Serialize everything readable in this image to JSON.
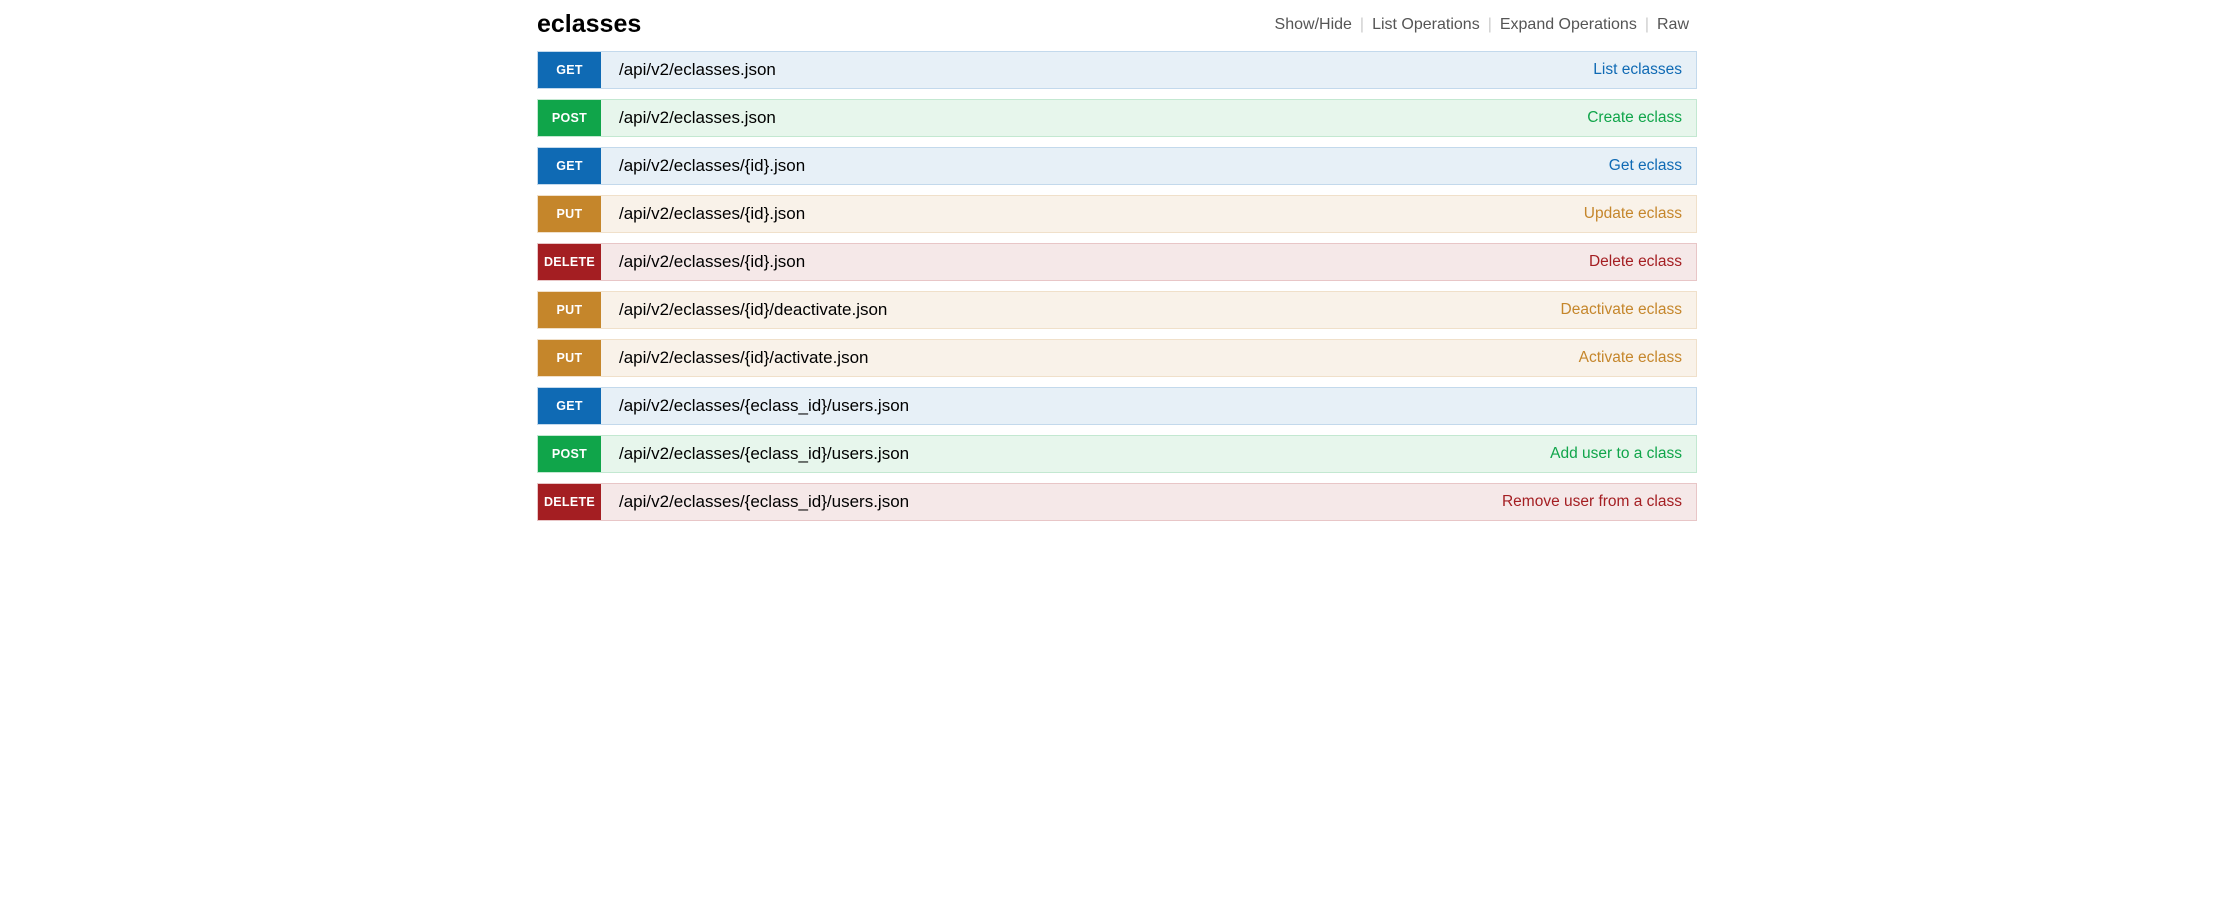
{
  "heading": "eclasses",
  "options": {
    "show_hide": "Show/Hide",
    "list_operations": "List Operations",
    "expand_operations": "Expand Operations",
    "raw": "Raw"
  },
  "endpoints": [
    {
      "method": "GET",
      "path": "/api/v2/eclasses.json",
      "summary": "List eclasses"
    },
    {
      "method": "POST",
      "path": "/api/v2/eclasses.json",
      "summary": "Create eclass"
    },
    {
      "method": "GET",
      "path": "/api/v2/eclasses/{id}.json",
      "summary": "Get eclass"
    },
    {
      "method": "PUT",
      "path": "/api/v2/eclasses/{id}.json",
      "summary": "Update eclass"
    },
    {
      "method": "DELETE",
      "path": "/api/v2/eclasses/{id}.json",
      "summary": "Delete eclass"
    },
    {
      "method": "PUT",
      "path": "/api/v2/eclasses/{id}/deactivate.json",
      "summary": "Deactivate eclass"
    },
    {
      "method": "PUT",
      "path": "/api/v2/eclasses/{id}/activate.json",
      "summary": "Activate eclass"
    },
    {
      "method": "GET",
      "path": "/api/v2/eclasses/{eclass_id}/users.json",
      "summary": ""
    },
    {
      "method": "POST",
      "path": "/api/v2/eclasses/{eclass_id}/users.json",
      "summary": "Add user to a class"
    },
    {
      "method": "DELETE",
      "path": "/api/v2/eclasses/{eclass_id}/users.json",
      "summary": "Remove user from a class"
    }
  ]
}
